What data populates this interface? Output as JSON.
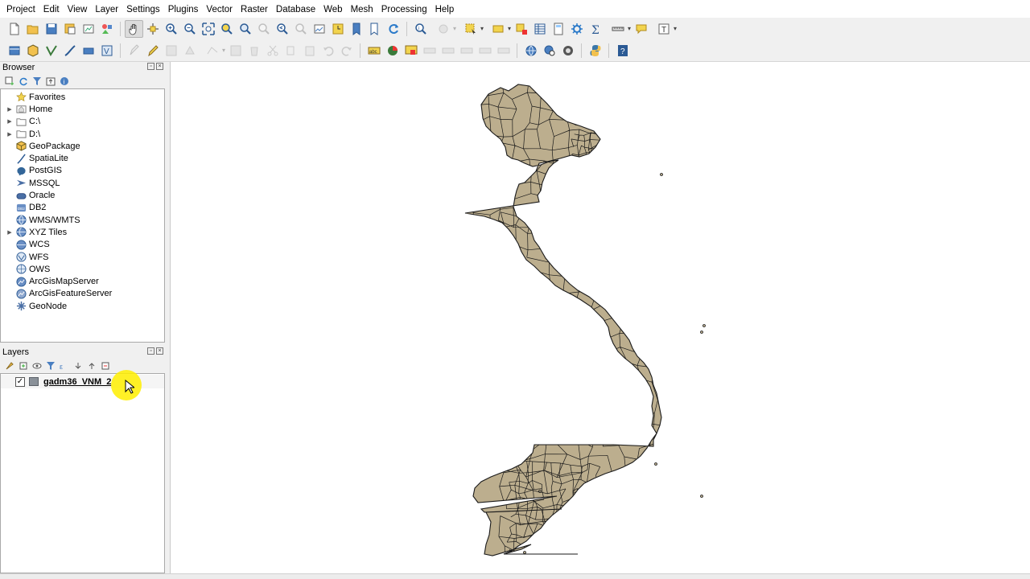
{
  "menubar": {
    "items": [
      "Project",
      "Edit",
      "View",
      "Layer",
      "Settings",
      "Plugins",
      "Vector",
      "Raster",
      "Database",
      "Web",
      "Mesh",
      "Processing",
      "Help"
    ]
  },
  "browser_panel": {
    "title": "Browser",
    "items": [
      {
        "label": "Favorites",
        "icon": "star-icon",
        "expandable": false
      },
      {
        "label": "Home",
        "icon": "home-folder-icon",
        "expandable": true
      },
      {
        "label": "C:\\",
        "icon": "drive-folder-icon",
        "expandable": true
      },
      {
        "label": "D:\\",
        "icon": "drive-folder-icon",
        "expandable": true
      },
      {
        "label": "GeoPackage",
        "icon": "geopackage-icon",
        "expandable": false
      },
      {
        "label": "SpatiaLite",
        "icon": "spatialite-icon",
        "expandable": false
      },
      {
        "label": "PostGIS",
        "icon": "postgis-elephant-icon",
        "expandable": false
      },
      {
        "label": "MSSQL",
        "icon": "mssql-icon",
        "expandable": false
      },
      {
        "label": "Oracle",
        "icon": "oracle-icon",
        "expandable": false
      },
      {
        "label": "DB2",
        "icon": "db2-icon",
        "expandable": false
      },
      {
        "label": "WMS/WMTS",
        "icon": "globe-wms-icon",
        "expandable": false
      },
      {
        "label": "XYZ Tiles",
        "icon": "globe-xyz-icon",
        "expandable": true
      },
      {
        "label": "WCS",
        "icon": "globe-wcs-icon",
        "expandable": false
      },
      {
        "label": "WFS",
        "icon": "globe-wfs-icon",
        "expandable": false
      },
      {
        "label": "OWS",
        "icon": "globe-ows-icon",
        "expandable": false
      },
      {
        "label": "ArcGisMapServer",
        "icon": "arcgis-map-icon",
        "expandable": false
      },
      {
        "label": "ArcGisFeatureServer",
        "icon": "arcgis-feature-icon",
        "expandable": false
      },
      {
        "label": "GeoNode",
        "icon": "geonode-icon",
        "expandable": false
      }
    ]
  },
  "layers_panel": {
    "title": "Layers",
    "layers": [
      {
        "name": "gadm36_VNM_2",
        "checked": true,
        "fill_color": "#8a9199"
      }
    ]
  },
  "map": {
    "feature_fill": "#bcae8e",
    "feature_stroke": "#1a1a1a",
    "background": "#ffffff"
  },
  "colors": {
    "cursor_highlight": "#ffee00",
    "menubar_bg": "#ffffff",
    "panel_bg": "#f0f0f0"
  }
}
